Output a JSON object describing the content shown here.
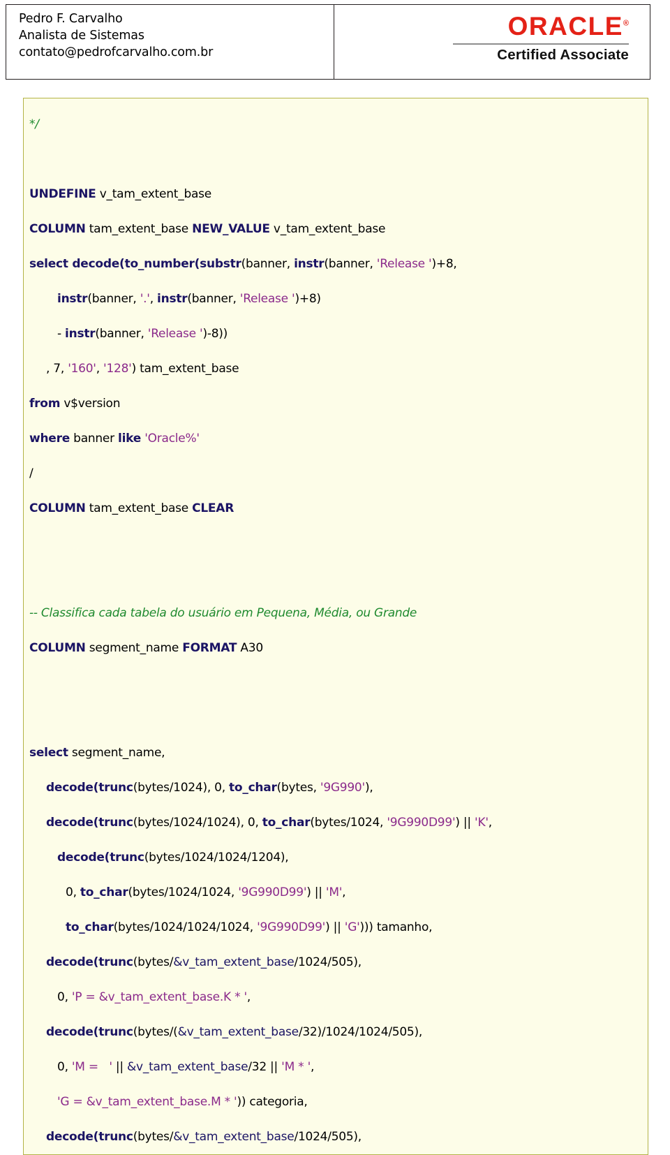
{
  "header": {
    "contact": {
      "name": "Pedro F. Carvalho",
      "role": "Analista de Sistemas",
      "email": "contato@pedrofcarvalho.com.br"
    },
    "badge": {
      "brand": "ORACLE",
      "registered_mark": "®",
      "subtitle": "Certified Associate",
      "brand_color": "#e42217"
    }
  },
  "code_block": {
    "background_color": "#fdfde8",
    "border_color": "#b3b346",
    "keyword_color": "#1b1464",
    "string_color": "#8b2a8b",
    "comment_color": "#1f8a2f",
    "lines": [
      {
        "indent": "i0",
        "blank": false,
        "tokens": [
          {
            "t": "cmt",
            "v": "*/"
          }
        ]
      },
      {
        "indent": "i0",
        "blank": true,
        "tokens": []
      },
      {
        "indent": "i0",
        "blank": false,
        "tokens": [
          {
            "t": "kw",
            "v": "UNDEFINE"
          },
          {
            "t": "pl",
            "v": " v_tam_extent_base"
          }
        ]
      },
      {
        "indent": "i0",
        "blank": false,
        "tokens": [
          {
            "t": "kw",
            "v": "COLUMN"
          },
          {
            "t": "pl",
            "v": " tam_extent_base "
          },
          {
            "t": "kw",
            "v": "NEW_VALUE"
          },
          {
            "t": "pl",
            "v": " v_tam_extent_base"
          }
        ]
      },
      {
        "indent": "i0",
        "blank": false,
        "tokens": [
          {
            "t": "kw",
            "v": "select decode("
          },
          {
            "t": "kw",
            "v": "to_number("
          },
          {
            "t": "kw",
            "v": "substr"
          },
          {
            "t": "pl",
            "v": "(banner, "
          },
          {
            "t": "kw",
            "v": "instr"
          },
          {
            "t": "pl",
            "v": "(banner, "
          },
          {
            "t": "str",
            "v": "'Release '"
          },
          {
            "t": "pl",
            "v": ")+8,"
          }
        ]
      },
      {
        "indent": "i2",
        "blank": false,
        "tokens": [
          {
            "t": "kw",
            "v": "instr"
          },
          {
            "t": "pl",
            "v": "(banner, "
          },
          {
            "t": "str",
            "v": "'.'"
          },
          {
            "t": "pl",
            "v": ", "
          },
          {
            "t": "kw",
            "v": "instr"
          },
          {
            "t": "pl",
            "v": "(banner, "
          },
          {
            "t": "str",
            "v": "'Release '"
          },
          {
            "t": "pl",
            "v": ")+8)"
          }
        ]
      },
      {
        "indent": "i2",
        "blank": false,
        "tokens": [
          {
            "t": "pl",
            "v": "- "
          },
          {
            "t": "kw",
            "v": "instr"
          },
          {
            "t": "pl",
            "v": "(banner, "
          },
          {
            "t": "str",
            "v": "'Release '"
          },
          {
            "t": "pl",
            "v": ")-8))"
          }
        ]
      },
      {
        "indent": "i1",
        "blank": false,
        "tokens": [
          {
            "t": "pl",
            "v": ", 7, "
          },
          {
            "t": "str",
            "v": "'160'"
          },
          {
            "t": "pl",
            "v": ", "
          },
          {
            "t": "str",
            "v": "'128'"
          },
          {
            "t": "pl",
            "v": ") tam_extent_base"
          }
        ]
      },
      {
        "indent": "i0",
        "blank": false,
        "tokens": [
          {
            "t": "kw",
            "v": "from"
          },
          {
            "t": "pl",
            "v": " v$version"
          }
        ]
      },
      {
        "indent": "i0",
        "blank": false,
        "tokens": [
          {
            "t": "kw",
            "v": "where"
          },
          {
            "t": "pl",
            "v": " banner "
          },
          {
            "t": "kw",
            "v": "like"
          },
          {
            "t": "pl",
            "v": " "
          },
          {
            "t": "str",
            "v": "'Oracle%'"
          }
        ]
      },
      {
        "indent": "i0",
        "blank": false,
        "tokens": [
          {
            "t": "pl",
            "v": "/"
          }
        ]
      },
      {
        "indent": "i0",
        "blank": false,
        "tokens": [
          {
            "t": "kw",
            "v": "COLUMN"
          },
          {
            "t": "pl",
            "v": " tam_extent_base "
          },
          {
            "t": "kw",
            "v": "CLEAR"
          }
        ]
      },
      {
        "indent": "i0",
        "blank": true,
        "tokens": []
      },
      {
        "indent": "i0",
        "blank": true,
        "tokens": []
      },
      {
        "indent": "i0",
        "blank": false,
        "tokens": [
          {
            "t": "cmt",
            "v": "-- Classifica cada tabela do usuário em Pequena, Média, ou Grande"
          }
        ]
      },
      {
        "indent": "i0",
        "blank": false,
        "tokens": [
          {
            "t": "kw",
            "v": "COLUMN"
          },
          {
            "t": "pl",
            "v": " segment_name "
          },
          {
            "t": "kw",
            "v": "FORMAT"
          },
          {
            "t": "pl",
            "v": " A30"
          }
        ]
      },
      {
        "indent": "i0",
        "blank": true,
        "tokens": []
      },
      {
        "indent": "i0",
        "blank": true,
        "tokens": []
      },
      {
        "indent": "i0",
        "blank": false,
        "tokens": [
          {
            "t": "kw",
            "v": "select"
          },
          {
            "t": "pl",
            "v": " segment_name,"
          }
        ]
      },
      {
        "indent": "i1",
        "blank": false,
        "tokens": [
          {
            "t": "kw",
            "v": "decode("
          },
          {
            "t": "kw",
            "v": "trunc"
          },
          {
            "t": "pl",
            "v": "(bytes/1024), 0, "
          },
          {
            "t": "kw",
            "v": "to_char"
          },
          {
            "t": "pl",
            "v": "(bytes, "
          },
          {
            "t": "str",
            "v": "'9G990'"
          },
          {
            "t": "pl",
            "v": "),"
          }
        ]
      },
      {
        "indent": "i1",
        "blank": false,
        "tokens": [
          {
            "t": "kw",
            "v": "decode("
          },
          {
            "t": "kw",
            "v": "trunc"
          },
          {
            "t": "pl",
            "v": "(bytes/1024/1024), 0, "
          },
          {
            "t": "kw",
            "v": "to_char"
          },
          {
            "t": "pl",
            "v": "(bytes/1024, "
          },
          {
            "t": "str",
            "v": "'9G990D99'"
          },
          {
            "t": "pl",
            "v": ") || "
          },
          {
            "t": "str",
            "v": "'K'"
          },
          {
            "t": "pl",
            "v": ","
          }
        ]
      },
      {
        "indent": "i2",
        "blank": false,
        "tokens": [
          {
            "t": "kw",
            "v": "decode("
          },
          {
            "t": "kw",
            "v": "trunc"
          },
          {
            "t": "pl",
            "v": "(bytes/1024/1024/1204),"
          }
        ]
      },
      {
        "indent": "i3",
        "blank": false,
        "tokens": [
          {
            "t": "pl",
            "v": "0, "
          },
          {
            "t": "kw",
            "v": "to_char"
          },
          {
            "t": "pl",
            "v": "(bytes/1024/1024, "
          },
          {
            "t": "str",
            "v": "'9G990D99'"
          },
          {
            "t": "pl",
            "v": ") || "
          },
          {
            "t": "str",
            "v": "'M'"
          },
          {
            "t": "pl",
            "v": ","
          }
        ]
      },
      {
        "indent": "i3",
        "blank": false,
        "tokens": [
          {
            "t": "kw",
            "v": "to_char"
          },
          {
            "t": "pl",
            "v": "(bytes/1024/1024/1024, "
          },
          {
            "t": "str",
            "v": "'9G990D99'"
          },
          {
            "t": "pl",
            "v": ") || "
          },
          {
            "t": "str",
            "v": "'G'"
          },
          {
            "t": "pl",
            "v": "))) tamanho,"
          }
        ]
      },
      {
        "indent": "i1",
        "blank": false,
        "tokens": [
          {
            "t": "kw",
            "v": "decode("
          },
          {
            "t": "kw",
            "v": "trunc"
          },
          {
            "t": "pl",
            "v": "(bytes/"
          },
          {
            "t": "var",
            "v": "&v_tam_extent_base"
          },
          {
            "t": "pl",
            "v": "/1024/505),"
          }
        ]
      },
      {
        "indent": "i2",
        "blank": false,
        "tokens": [
          {
            "t": "pl",
            "v": "0, "
          },
          {
            "t": "str",
            "v": "'P = &v_tam_extent_base.K * '"
          },
          {
            "t": "pl",
            "v": ","
          }
        ]
      },
      {
        "indent": "i1",
        "blank": false,
        "tokens": [
          {
            "t": "kw",
            "v": "decode("
          },
          {
            "t": "kw",
            "v": "trunc"
          },
          {
            "t": "pl",
            "v": "(bytes/("
          },
          {
            "t": "var",
            "v": "&v_tam_extent_base"
          },
          {
            "t": "pl",
            "v": "/32)/1024/1024/505),"
          }
        ]
      },
      {
        "indent": "i2",
        "blank": false,
        "tokens": [
          {
            "t": "pl",
            "v": "0, "
          },
          {
            "t": "str",
            "v": "'M =   '"
          },
          {
            "t": "pl",
            "v": " || "
          },
          {
            "t": "var",
            "v": "&v_tam_extent_base"
          },
          {
            "t": "pl",
            "v": "/32 || "
          },
          {
            "t": "str",
            "v": "'M * '"
          },
          {
            "t": "pl",
            "v": ","
          }
        ]
      },
      {
        "indent": "i2",
        "blank": false,
        "tokens": [
          {
            "t": "str",
            "v": "'G = &v_tam_extent_base.M * '"
          },
          {
            "t": "pl",
            "v": ")) categoria,"
          }
        ]
      },
      {
        "indent": "i1",
        "blank": false,
        "tokens": [
          {
            "t": "kw",
            "v": "decode("
          },
          {
            "t": "kw",
            "v": "trunc"
          },
          {
            "t": "pl",
            "v": "(bytes/"
          },
          {
            "t": "var",
            "v": "&v_tam_extent_base"
          },
          {
            "t": "pl",
            "v": "/1024/505),"
          }
        ]
      }
    ]
  }
}
